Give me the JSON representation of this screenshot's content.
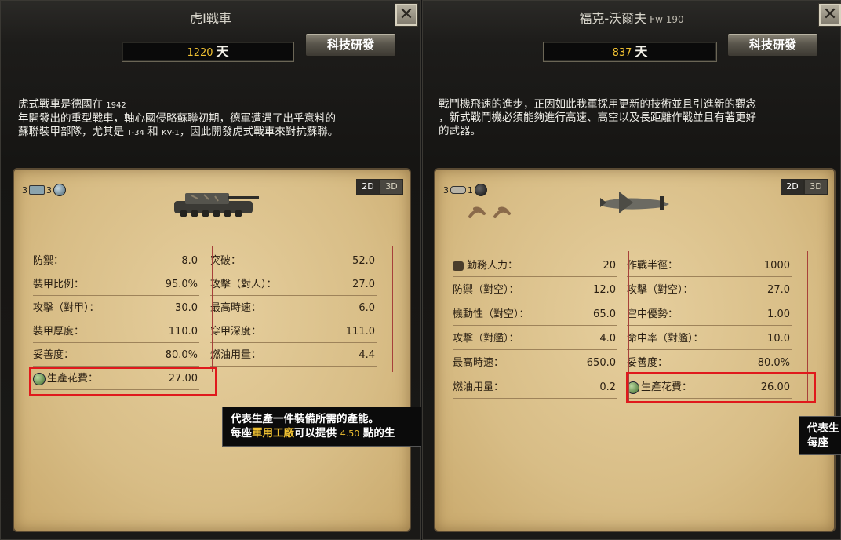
{
  "left": {
    "title": "虎I戰車",
    "close": "✕",
    "days_value": "1220",
    "days_unit": "天",
    "tech_button": "科技研發",
    "desc_line1_a": "虎式戰車是德國在",
    "desc_line1_b": "1942",
    "desc_line2": "年開發出的重型戰車，軸心國侵略蘇聯初期，德軍遭遇了出乎意料的",
    "desc_line3_a": "蘇聯裝甲部隊，尤其是",
    "desc_line3_b": "T-34",
    "desc_line3_c": "和",
    "desc_line3_d": "KV-1",
    "desc_line3_e": "，因此開發虎式戰車來對抗蘇聯。",
    "badge1": "3",
    "badge2": "3",
    "toggle_2d": "2D",
    "toggle_3d": "3D",
    "unit_icon": "tiger-tank-icon",
    "stats": [
      {
        "label": "防禦：",
        "value": "8.0"
      },
      {
        "label": "突破：",
        "value": "52.0"
      },
      {
        "label": "裝甲比例：",
        "value": "95.0%"
      },
      {
        "label": "攻擊（對人）：",
        "value": "27.0"
      },
      {
        "label": "攻擊（對甲）：",
        "value": "30.0"
      },
      {
        "label": "最高時速：",
        "value": "6.0"
      },
      {
        "label": "裝甲厚度：",
        "value": "110.0"
      },
      {
        "label": "穿甲深度：",
        "value": "111.0"
      },
      {
        "label": "妥善度：",
        "value": "80.0%"
      },
      {
        "label": "燃油用量：",
        "value": "4.4"
      },
      {
        "label": "生產花費：",
        "value": "27.00"
      }
    ],
    "tooltip_line1": "代表生產一件裝備所需的產能。",
    "tooltip_a": "每座",
    "tooltip_b": "軍用工廠",
    "tooltip_c": "可以提供",
    "tooltip_d": "4.50",
    "tooltip_e": "點的生"
  },
  "right": {
    "title": "福克-沃爾夫",
    "title_small": "Fw 190",
    "close": "✕",
    "days_value": "837",
    "days_unit": "天",
    "tech_button": "科技研發",
    "desc_line1": "戰鬥機飛速的進步，正因如此我軍採用更新的技術並且引進新的觀念",
    "desc_line2": "，新式戰鬥機必須能夠進行高速、高空以及長距離作戰並且有著更好",
    "desc_line3": "的武器。",
    "badge1": "3",
    "badge2": "1",
    "toggle_2d": "2D",
    "toggle_3d": "3D",
    "unit_icon": "fw190-plane-icon",
    "stats": [
      {
        "label": "勤務人力：",
        "value": "20"
      },
      {
        "label": "作戰半徑：",
        "value": "1000"
      },
      {
        "label": "防禦（對空）：",
        "value": "12.0"
      },
      {
        "label": "攻擊（對空）：",
        "value": "27.0"
      },
      {
        "label": "機動性（對空）：",
        "value": "65.0"
      },
      {
        "label": "空中優勢：",
        "value": "1.00"
      },
      {
        "label": "攻擊（對艦）：",
        "value": "4.0"
      },
      {
        "label": "命中率（對艦）：",
        "value": "10.0"
      },
      {
        "label": "最高時速：",
        "value": "650.0"
      },
      {
        "label": "妥善度：",
        "value": "80.0%"
      },
      {
        "label": "燃油用量：",
        "value": "0.2"
      },
      {
        "label": "生產花費：",
        "value": "26.00"
      }
    ],
    "tooltip_line1": "代表生",
    "tooltip_line2": "每座"
  }
}
